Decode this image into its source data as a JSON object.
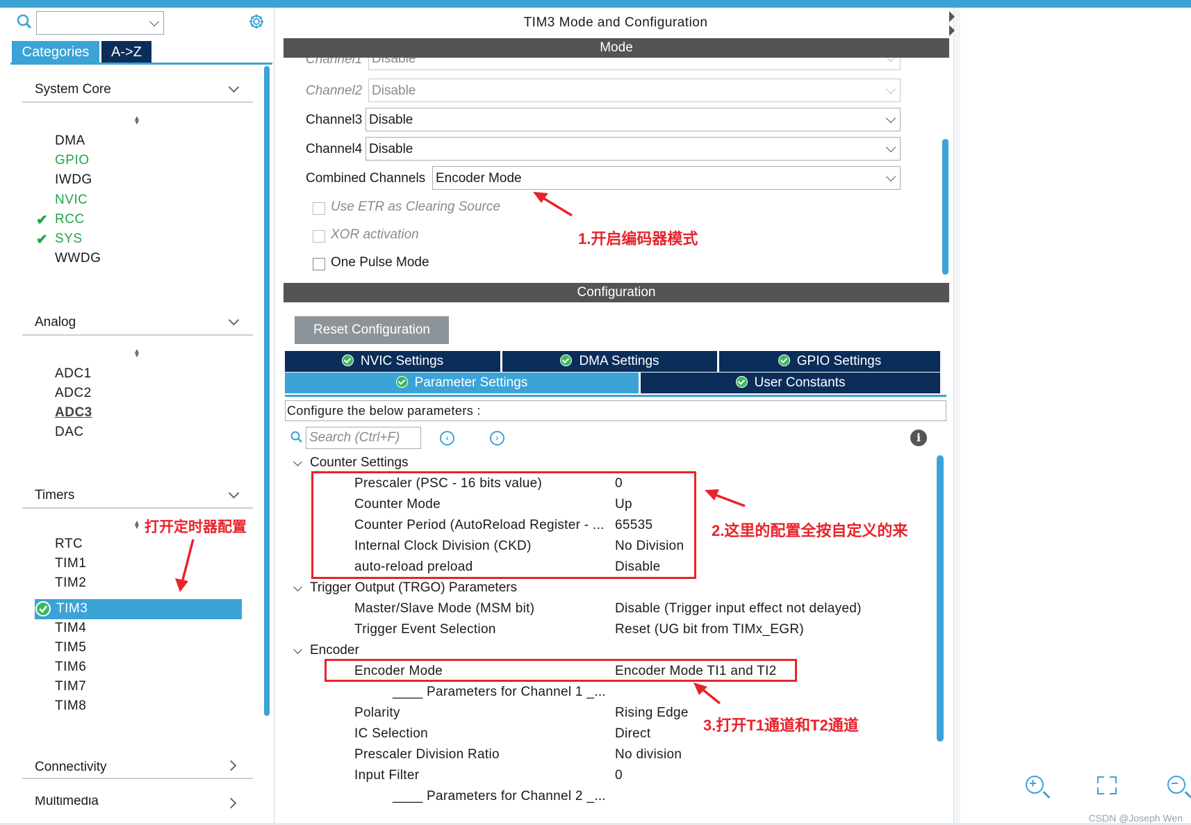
{
  "left": {
    "tabs": [
      "Categories",
      "A->Z"
    ],
    "sections": {
      "system_core": {
        "title": "System Core",
        "items": [
          "DMA",
          "GPIO",
          "IWDG",
          "NVIC",
          "RCC",
          "SYS",
          "WWDG"
        ]
      },
      "analog": {
        "title": "Analog",
        "items": [
          "ADC1",
          "ADC2",
          "ADC3",
          "DAC"
        ]
      },
      "timers": {
        "title": "Timers",
        "items": [
          "RTC",
          "TIM1",
          "TIM2",
          "TIM3",
          "TIM4",
          "TIM5",
          "TIM6",
          "TIM7",
          "TIM8"
        ],
        "selected": "TIM3"
      },
      "connectivity": {
        "title": "Connectivity"
      },
      "multimedia": {
        "title": "Multimedia"
      }
    },
    "annotation": "打开定时器配置"
  },
  "center": {
    "title": "TIM3 Mode and Configuration",
    "mode_header": "Mode",
    "mode_rows": [
      {
        "label": "Channel1",
        "value": "Disable"
      },
      {
        "label": "Channel2",
        "value": "Disable"
      },
      {
        "label": "Channel3",
        "value": "Disable"
      },
      {
        "label": "Channel4",
        "value": "Disable"
      },
      {
        "label": "Combined Channels",
        "value": "Encoder Mode"
      }
    ],
    "checkboxes": [
      "Use ETR as Clearing Source",
      "XOR activation",
      "One Pulse Mode"
    ],
    "annotation1": "1.开启编码器模式",
    "config_header": "Configuration",
    "reset_button": "Reset Configuration",
    "tabs_row1": [
      "NVIC Settings",
      "DMA Settings",
      "GPIO Settings"
    ],
    "tabs_row2": [
      "Parameter Settings",
      "User Constants"
    ],
    "description": "Configure the below parameters :",
    "search_placeholder": "Search (Ctrl+F)",
    "groups": {
      "counter": {
        "title": "Counter Settings",
        "params": [
          {
            "name": "Prescaler (PSC - 16 bits value)",
            "value": "0"
          },
          {
            "name": "Counter Mode",
            "value": "Up"
          },
          {
            "name": "Counter Period (AutoReload Register - ...",
            "value": "65535"
          },
          {
            "name": "Internal Clock Division (CKD)",
            "value": "No Division"
          },
          {
            "name": "auto-reload preload",
            "value": "Disable"
          }
        ]
      },
      "trigger": {
        "title": "Trigger Output (TRGO) Parameters",
        "params": [
          {
            "name": "Master/Slave Mode (MSM bit)",
            "value": "Disable (Trigger input effect not delayed)"
          },
          {
            "name": "Trigger Event Selection",
            "value": "Reset (UG bit from TIMx_EGR)"
          }
        ]
      },
      "encoder": {
        "title": "Encoder",
        "mode": {
          "name": "Encoder Mode",
          "value": "Encoder Mode TI1 and TI2"
        },
        "ch1_header": "____ Parameters for Channel 1 _...",
        "params": [
          {
            "name": "Polarity",
            "value": "Rising Edge"
          },
          {
            "name": "IC Selection",
            "value": "Direct"
          },
          {
            "name": "Prescaler Division Ratio",
            "value": "No division"
          },
          {
            "name": "Input Filter",
            "value": "0"
          }
        ],
        "ch2_header": "____ Parameters for Channel 2 _..."
      }
    },
    "annotation2": "2.这里的配置全按自定义的来",
    "annotation3": "3.打开T1通道和T2通道"
  },
  "watermark": "CSDN @Joseph Wen",
  "colors": {
    "accent": "#3ba3d6",
    "dark_tab": "#0a2d5a",
    "header_bar": "#545454",
    "ok_green": "#1fa64a",
    "annotation_red": "#e8232a"
  }
}
